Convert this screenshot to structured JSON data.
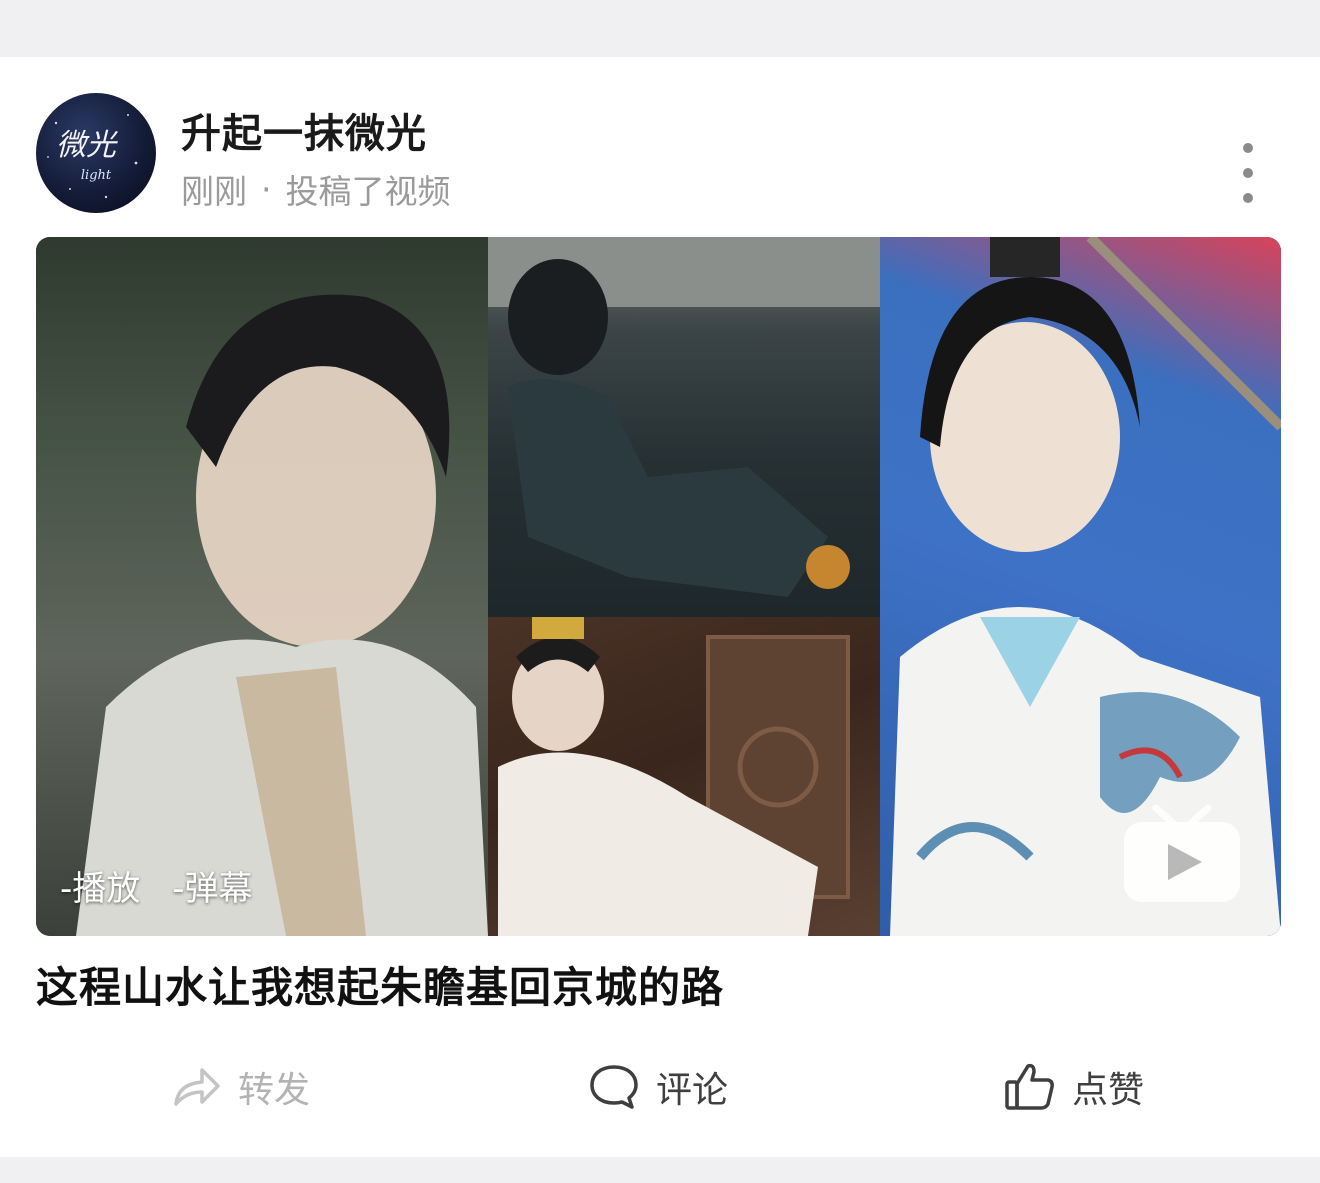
{
  "post": {
    "author": "升起一抹微光",
    "time": "刚刚",
    "separator": "·",
    "action_text": "投稿了视频",
    "title": "这程山水让我想起朱瞻基回京城的路",
    "avatar_icon": "avatar-logo-icon",
    "avatar_text": "微光",
    "avatar_text_sub": "light"
  },
  "video": {
    "plays": "-播放",
    "danmaku": "-弹幕",
    "play_icon": "play-button-icon"
  },
  "actions": {
    "repost": "转发",
    "comment": "评论",
    "like": "点赞"
  },
  "colors": {
    "background": "#f0f0f2",
    "card": "#ffffff",
    "muted_text": "#9a9a9a",
    "disabled_action": "#b3b3b3"
  }
}
